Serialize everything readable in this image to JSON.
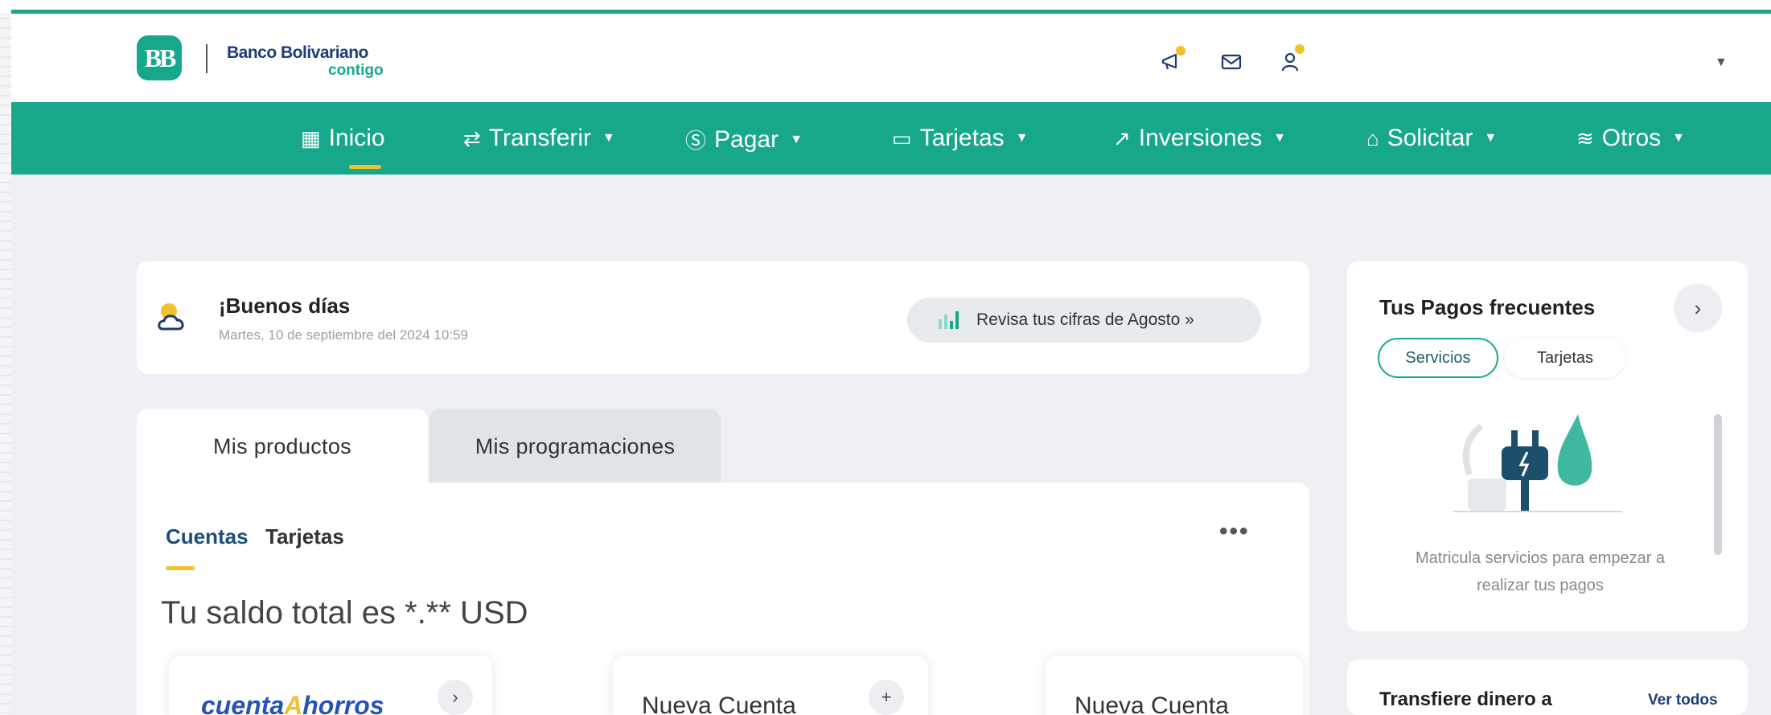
{
  "brand": {
    "logo_text": "BB",
    "name": "Banco Bolivariano",
    "tagline": "contigo"
  },
  "header": {
    "icons": [
      "megaphone-icon",
      "mail-icon",
      "user-icon"
    ],
    "user_name": "",
    "accent_color": "#17a88c",
    "notification_color": "#f2c12e"
  },
  "nav": {
    "items": [
      {
        "label": "Inicio",
        "icon": "dashboard-icon",
        "active": true
      },
      {
        "label": "Transferir",
        "icon": "transfer-icon"
      },
      {
        "label": "Pagar",
        "icon": "dollar-icon"
      },
      {
        "label": "Tarjetas",
        "icon": "card-icon"
      },
      {
        "label": "Inversiones",
        "icon": "trend-icon"
      },
      {
        "label": "Solicitar",
        "icon": "bank-icon"
      },
      {
        "label": "Otros",
        "icon": "layers-icon"
      }
    ]
  },
  "greeting": {
    "title": "¡Buenos días",
    "date": "Martes, 10 de septiembre del 2024 10:59",
    "stats_button": "Revisa tus cifras de Agosto »"
  },
  "tabs": {
    "products": "Mis productos",
    "schedules": "Mis programaciones"
  },
  "products": {
    "subtabs": [
      "Cuentas",
      "Tarjetas"
    ],
    "more": "•••",
    "balance": "Tu saldo total es *.** USD",
    "cards": [
      {
        "logo_part1": "cuenta",
        "logo_part2": "horros"
      },
      {
        "title": "Nueva Cuenta"
      },
      {
        "title": "Nueva Cuenta"
      }
    ]
  },
  "frequent_payments": {
    "title": "Tus Pagos frecuentes",
    "chips": [
      "Servicios",
      "Tarjetas"
    ],
    "message": "Matricula servicios para empezar a realizar tus pagos"
  },
  "transfer": {
    "title": "Transfiere dinero a",
    "link": "Ver todos"
  }
}
